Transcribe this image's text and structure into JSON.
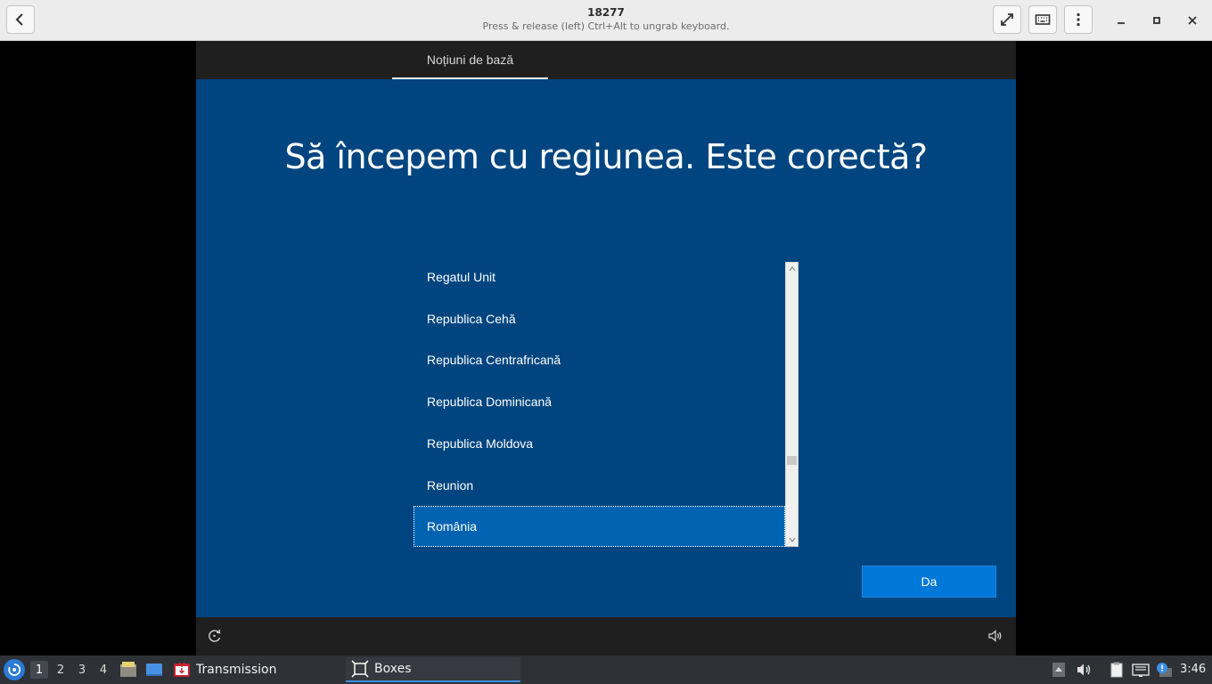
{
  "window": {
    "title": "18277",
    "subtitle": "Press & release (left) Ctrl+Alt to ungrab keyboard."
  },
  "vm": {
    "tab": "Noțiuni de bază",
    "heading": "Să începem cu regiunea. Este corectă?",
    "regions": [
      "Regatul Unit",
      "Republica Cehă",
      "Republica Centrafricană",
      "Republica Dominicană",
      "Republica Moldova",
      "Reunion",
      "România"
    ],
    "selected_region": "România",
    "scroll_position": 0.72,
    "confirm_label": "Da"
  },
  "taskbar": {
    "workspaces": [
      "1",
      "2",
      "3",
      "4"
    ],
    "active_workspace": "1",
    "tasks": [
      "Transmission",
      "Boxes"
    ],
    "active_task": "Boxes",
    "clock": "3:46"
  },
  "colors": {
    "vm_background": "#00457f",
    "selection": "#0063b1",
    "accent_button": "#0078d7",
    "taskbar": "#2e3136"
  },
  "icons": [
    "back-arrow-icon",
    "fullscreen-icon",
    "keyboard-icon",
    "kebab-menu-icon",
    "minimize-icon",
    "maximize-icon",
    "close-icon",
    "ease-of-access-icon",
    "volume-icon",
    "start-menu-icon",
    "file-manager-icon",
    "desktop-icon",
    "transmission-icon",
    "boxes-icon",
    "clipboard-icon",
    "network-icon",
    "update-icon"
  ]
}
